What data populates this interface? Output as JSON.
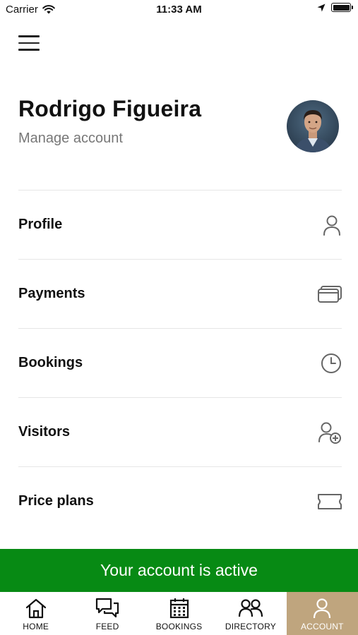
{
  "status_bar": {
    "carrier": "Carrier",
    "time": "11:33 AM"
  },
  "header": {
    "menu_icon": "hamburger-icon"
  },
  "profile": {
    "name": "Rodrigo Figueira",
    "manage_label": "Manage account",
    "avatar": "user-avatar-photo"
  },
  "menu": {
    "items": [
      {
        "label": "Profile",
        "icon": "user-icon"
      },
      {
        "label": "Payments",
        "icon": "cards-icon"
      },
      {
        "label": "Bookings",
        "icon": "clock-icon"
      },
      {
        "label": "Visitors",
        "icon": "add-user-icon"
      },
      {
        "label": "Price plans",
        "icon": "ticket-icon"
      }
    ]
  },
  "banner": {
    "text": "Your account is active",
    "color": "#078a14"
  },
  "tab_bar": {
    "active_color": "#bfa57e",
    "tabs": [
      {
        "label": "HOME",
        "icon": "home-icon"
      },
      {
        "label": "FEED",
        "icon": "chat-icon"
      },
      {
        "label": "BOOKINGS",
        "icon": "calendar-icon"
      },
      {
        "label": "DIRECTORY",
        "icon": "people-icon"
      },
      {
        "label": "ACCOUNT",
        "icon": "account-icon",
        "active": true
      }
    ]
  }
}
